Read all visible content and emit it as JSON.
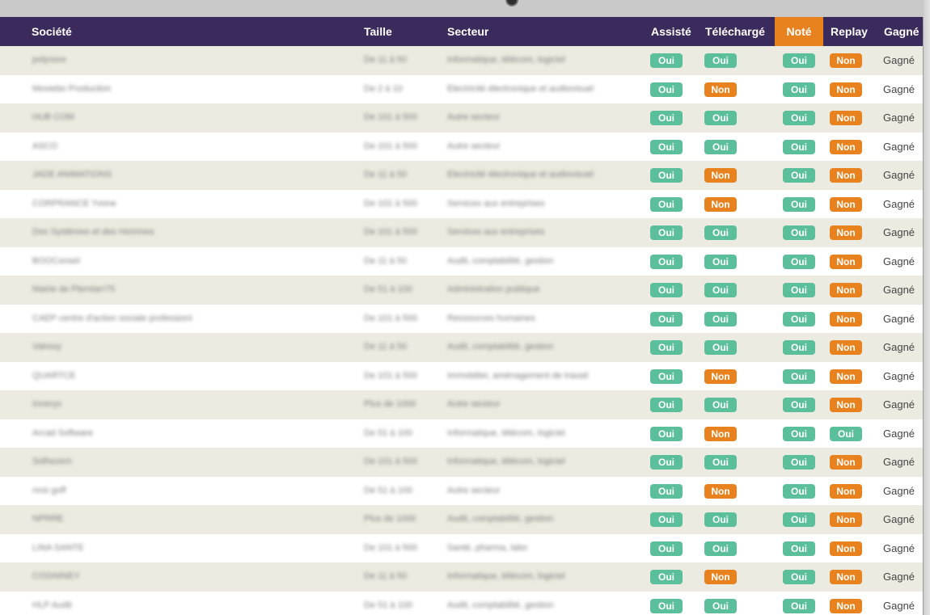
{
  "columns": {
    "societe": "Société",
    "taille": "Taille",
    "secteur": "Secteur",
    "assiste": "Assisté",
    "telecharge": "Téléchargé",
    "note": "Noté",
    "replay": "Replay",
    "gagne": "Gagné"
  },
  "colors": {
    "header_bg": "#3b2a5c",
    "active_header": "#e8821f",
    "oui": "#5cbf9c",
    "non": "#e8821f"
  },
  "rows": [
    {
      "societe": "polyvore",
      "taille": "De 11 à 50",
      "secteur": "Informatique, télécom, logiciel",
      "assiste": "Oui",
      "telecharge": "Oui",
      "note": "Oui",
      "replay": "Non",
      "gagne": "Gagné"
    },
    {
      "societe": "Moviebo Production",
      "taille": "De 2 à 10",
      "secteur": "Electricité électronique et audiovisuel",
      "assiste": "Oui",
      "telecharge": "Non",
      "note": "Oui",
      "replay": "Non",
      "gagne": "Gagné"
    },
    {
      "societe": "HUB COM",
      "taille": "De 101 à 500",
      "secteur": "Autre secteur",
      "assiste": "Oui",
      "telecharge": "Oui",
      "note": "Oui",
      "replay": "Non",
      "gagne": "Gagné"
    },
    {
      "societe": "ASCO",
      "taille": "De 101 à 500",
      "secteur": "Autre secteur",
      "assiste": "Oui",
      "telecharge": "Oui",
      "note": "Oui",
      "replay": "Non",
      "gagne": "Gagné"
    },
    {
      "societe": "JADE ANIMATIONS",
      "taille": "De 11 à 50",
      "secteur": "Electricité électronique et audiovisuel",
      "assiste": "Oui",
      "telecharge": "Non",
      "note": "Oui",
      "replay": "Non",
      "gagne": "Gagné"
    },
    {
      "societe": "CORPRANCE Yvone",
      "taille": "De 101 à 500",
      "secteur": "Services aux entreprises",
      "assiste": "Oui",
      "telecharge": "Non",
      "note": "Oui",
      "replay": "Non",
      "gagne": "Gagné"
    },
    {
      "societe": "Des Systèmes et des Hommes",
      "taille": "De 101 à 500",
      "secteur": "Services aux entreprises",
      "assiste": "Oui",
      "telecharge": "Oui",
      "note": "Oui",
      "replay": "Non",
      "gagne": "Gagné"
    },
    {
      "societe": "BOOConsel",
      "taille": "De 11 à 50",
      "secteur": "Audit, comptabilité, gestion",
      "assiste": "Oui",
      "telecharge": "Oui",
      "note": "Oui",
      "replay": "Non",
      "gagne": "Gagné"
    },
    {
      "societe": "Mairie de Plemtarr75",
      "taille": "De 51 à 100",
      "secteur": "Administration publique",
      "assiste": "Oui",
      "telecharge": "Oui",
      "note": "Oui",
      "replay": "Non",
      "gagne": "Gagné"
    },
    {
      "societe": "CAEP centre d'action sociale professioni",
      "taille": "De 101 à 500",
      "secteur": "Ressources humaines",
      "assiste": "Oui",
      "telecharge": "Oui",
      "note": "Oui",
      "replay": "Non",
      "gagne": "Gagné"
    },
    {
      "societe": "Valrexy",
      "taille": "De 11 à 50",
      "secteur": "Audit, comptabilité, gestion",
      "assiste": "Oui",
      "telecharge": "Oui",
      "note": "Oui",
      "replay": "Non",
      "gagne": "Gagné"
    },
    {
      "societe": "QUARTCE",
      "taille": "De 101 à 500",
      "secteur": "Immobilier, aménagement de travail",
      "assiste": "Oui",
      "telecharge": "Non",
      "note": "Oui",
      "replay": "Non",
      "gagne": "Gagné"
    },
    {
      "societe": "Innerys",
      "taille": "Plus de 1000",
      "secteur": "Autre secteur",
      "assiste": "Oui",
      "telecharge": "Oui",
      "note": "Oui",
      "replay": "Non",
      "gagne": "Gagné"
    },
    {
      "societe": "Arcad Software",
      "taille": "De 51 à 100",
      "secteur": "Informatique, télécom, logiciel",
      "assiste": "Oui",
      "telecharge": "Non",
      "note": "Oui",
      "replay": "Oui",
      "gagne": "Gagné"
    },
    {
      "societe": "Sidhezem",
      "taille": "De 101 à 500",
      "secteur": "Informatique, télécom, logiciel",
      "assiste": "Oui",
      "telecharge": "Oui",
      "note": "Oui",
      "replay": "Non",
      "gagne": "Gagné"
    },
    {
      "societe": "nnsi goff",
      "taille": "De 51 à 100",
      "secteur": "Autre secteur",
      "assiste": "Oui",
      "telecharge": "Non",
      "note": "Oui",
      "replay": "Non",
      "gagne": "Gagné"
    },
    {
      "societe": "NPRRE",
      "taille": "Plus de 1000",
      "secteur": "Audit, comptabilité, gestion",
      "assiste": "Oui",
      "telecharge": "Oui",
      "note": "Oui",
      "replay": "Non",
      "gagne": "Gagné"
    },
    {
      "societe": "LINA SANTE",
      "taille": "De 101 à 500",
      "secteur": "Santé, pharma, labo",
      "assiste": "Oui",
      "telecharge": "Oui",
      "note": "Oui",
      "replay": "Non",
      "gagne": "Gagné"
    },
    {
      "societe": "COGNINEY",
      "taille": "De 11 à 50",
      "secteur": "Informatique, télécom, logiciel",
      "assiste": "Oui",
      "telecharge": "Non",
      "note": "Oui",
      "replay": "Non",
      "gagne": "Gagné"
    },
    {
      "societe": "HLP Audit",
      "taille": "De 51 à 100",
      "secteur": "Audit, comptabilité, gestion",
      "assiste": "Oui",
      "telecharge": "Oui",
      "note": "Oui",
      "replay": "Non",
      "gagne": "Gagné"
    }
  ]
}
